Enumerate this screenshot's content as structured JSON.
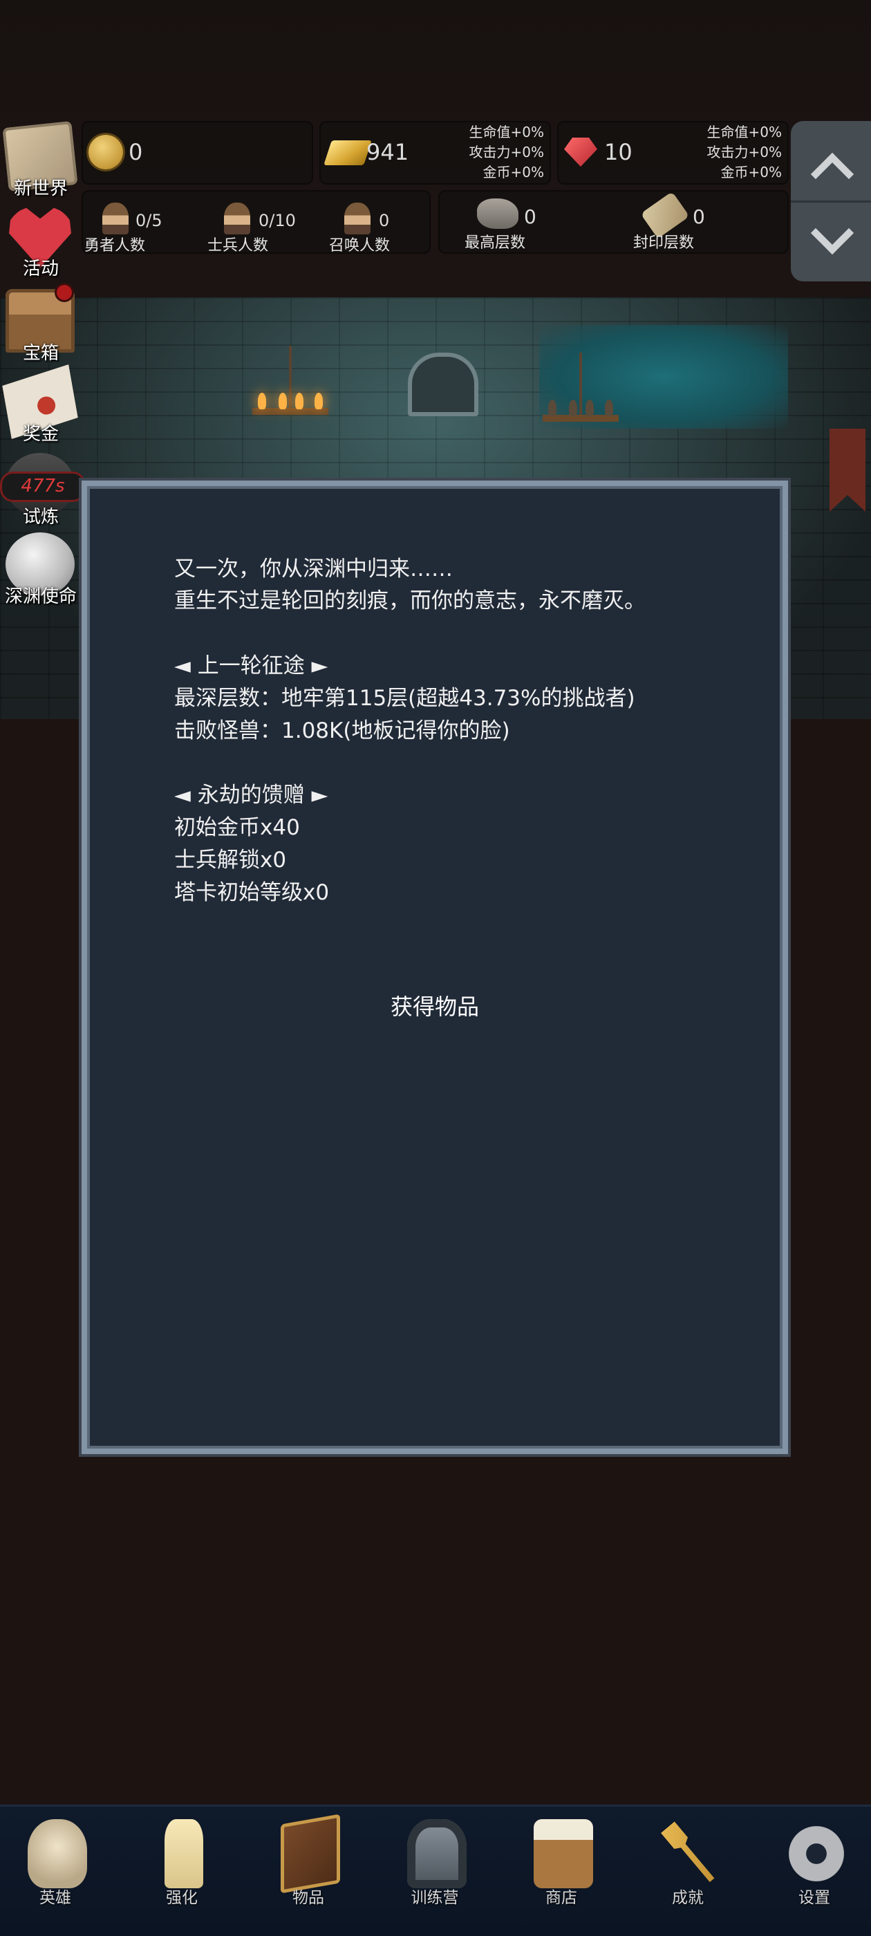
{
  "side_buttons": [
    {
      "label": "新世界"
    },
    {
      "label": "活动"
    },
    {
      "label": "宝箱"
    },
    {
      "label": "奖金"
    },
    {
      "label": "试炼",
      "timer": "477s"
    },
    {
      "label": "深渊使命"
    }
  ],
  "resources": {
    "coin": {
      "value": "0",
      "icon": "coin-icon"
    },
    "gold": {
      "value": "941",
      "icon": "gold-bar-icon",
      "bonus": [
        "生命值+0%",
        "攻击力+0%",
        "金币+0%"
      ]
    },
    "gem": {
      "value": "10",
      "icon": "red-gem-icon",
      "bonus": [
        "生命值+0%",
        "攻击力+0%",
        "金币+0%"
      ]
    }
  },
  "stats": {
    "heroes": {
      "count": "0/5",
      "label": "勇者人数"
    },
    "soldiers": {
      "count": "0/10",
      "label": "士兵人数"
    },
    "summons": {
      "count": "0",
      "label": "召唤人数"
    },
    "max_floor": {
      "count": "0",
      "label": "最高层数"
    },
    "seal_floor": {
      "count": "0",
      "label": "封印层数"
    }
  },
  "dialog": {
    "lines": [
      "又一次，你从深渊中归来……",
      "重生不过是轮回的刻痕，而你的意志，永不磨灭。",
      "◄ 上一轮征途 ►",
      "最深层数：地牢第115层(超越43.73%的挑战者)",
      "击败怪兽：1.08K(地板记得你的脸)",
      "◄ 永劫的馈赠 ►",
      "初始金币x40",
      "士兵解锁x0",
      "塔卡初始等级x0"
    ],
    "claim_label": "获得物品"
  },
  "bottom_nav": [
    {
      "label": "英雄",
      "icon": "skull-icon"
    },
    {
      "label": "强化",
      "icon": "candle-icon"
    },
    {
      "label": "物品",
      "icon": "book-icon"
    },
    {
      "label": "训练营",
      "icon": "lantern-icon"
    },
    {
      "label": "商店",
      "icon": "mug-icon"
    },
    {
      "label": "成就",
      "icon": "key-icon"
    },
    {
      "label": "设置",
      "icon": "gear-icon"
    }
  ]
}
